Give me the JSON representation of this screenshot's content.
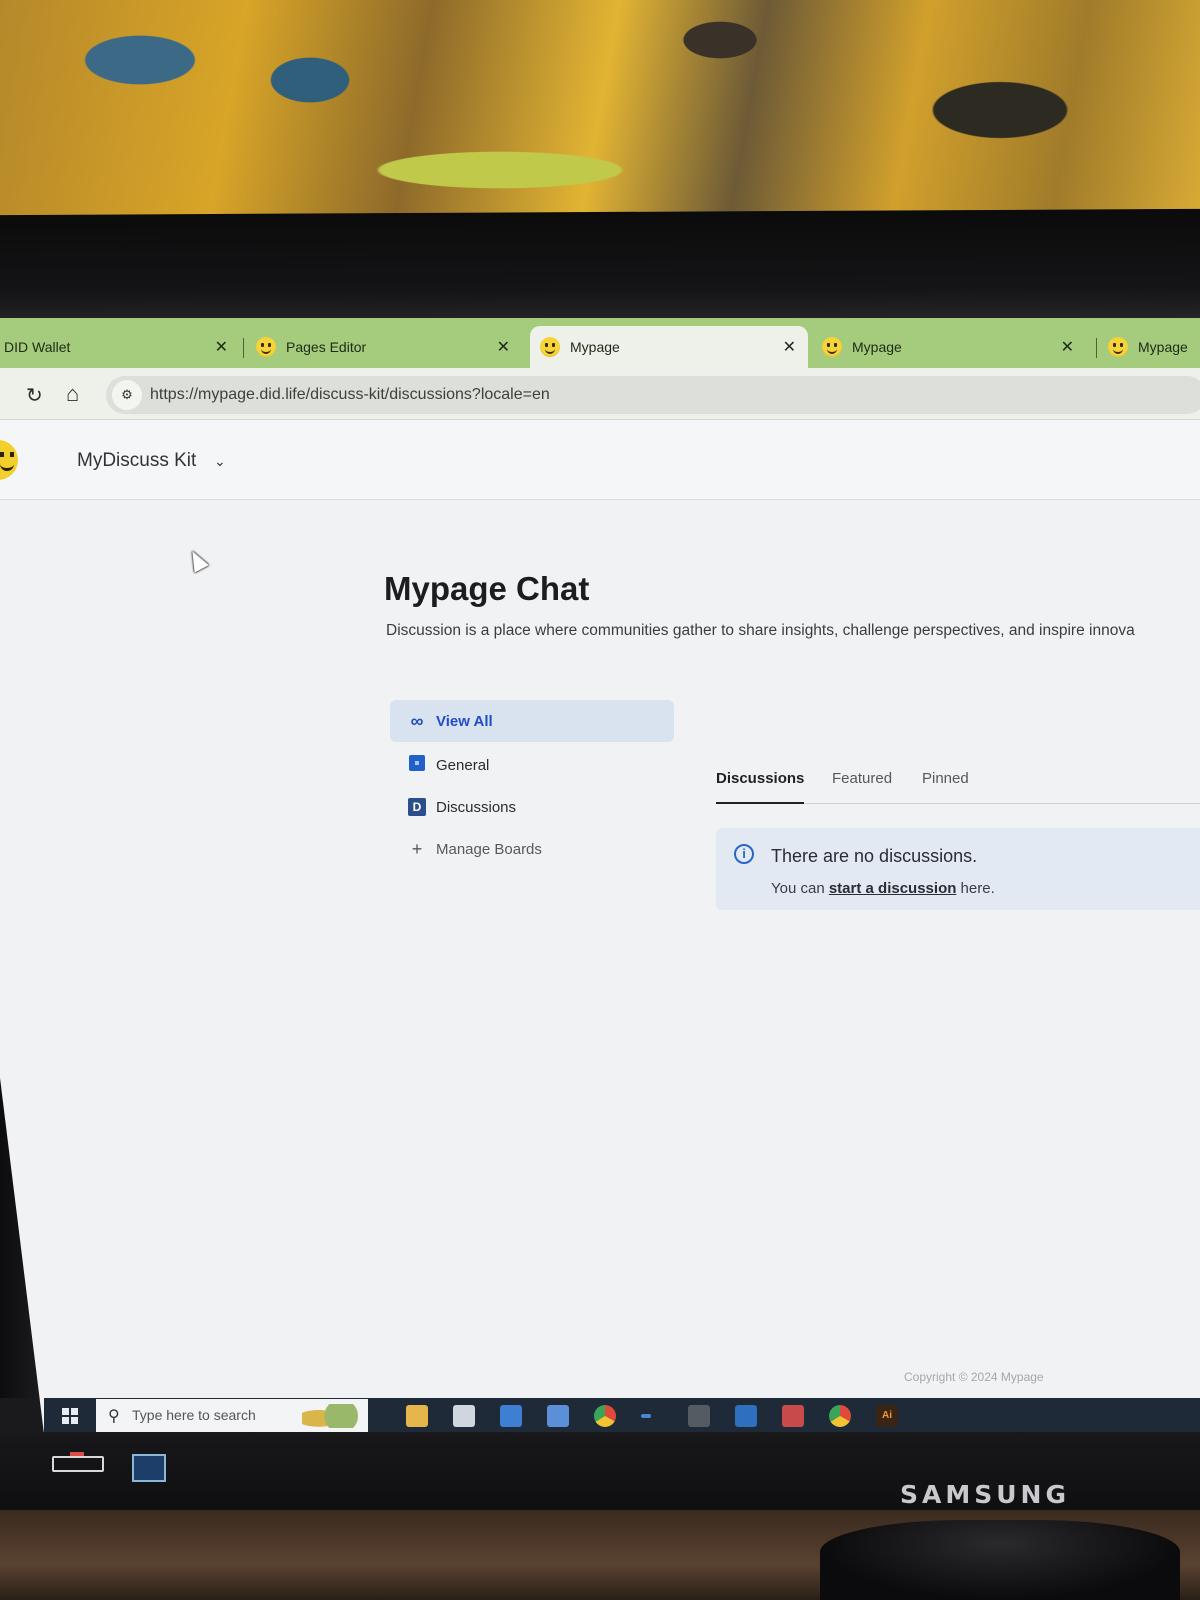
{
  "browser": {
    "tabs": [
      {
        "label": "DID Wallet",
        "close": "✕"
      },
      {
        "label": "Pages Editor",
        "close": "✕"
      },
      {
        "label": "Mypage",
        "close": "✕"
      },
      {
        "label": "Mypage",
        "close": "✕"
      },
      {
        "label": "Mypage"
      }
    ],
    "url": "https://mypage.did.life/discuss-kit/discussions?locale=en",
    "reload_icon": "↻",
    "home_icon": "⌂",
    "site_icon": "⚙"
  },
  "app": {
    "name": "MyDiscuss Kit",
    "chevron": "⌄"
  },
  "page": {
    "title": "Mypage Chat",
    "description": "Discussion is a place where communities gather to share insights, challenge perspectives, and inspire innova"
  },
  "boards": {
    "view_all": "View All",
    "general": "General",
    "discussions": "Discussions",
    "manage": "Manage Boards",
    "discussions_letter": "D"
  },
  "feed": {
    "tabs": [
      "Discussions",
      "Featured",
      "Pinned"
    ],
    "empty_title": "There are no discussions.",
    "empty_prefix": "You can ",
    "empty_link": "start a discussion",
    "empty_suffix": " here."
  },
  "footer": {
    "copyright": "Copyright © 2024 Mypage"
  },
  "taskbar": {
    "search_placeholder": "Type here to search"
  },
  "monitor": {
    "brand": "SAMSUNG"
  },
  "colors": {
    "accent": "#1f4fc7",
    "tabstrip": "#a4cc7c",
    "alert_bg": "#e2e9f2"
  }
}
